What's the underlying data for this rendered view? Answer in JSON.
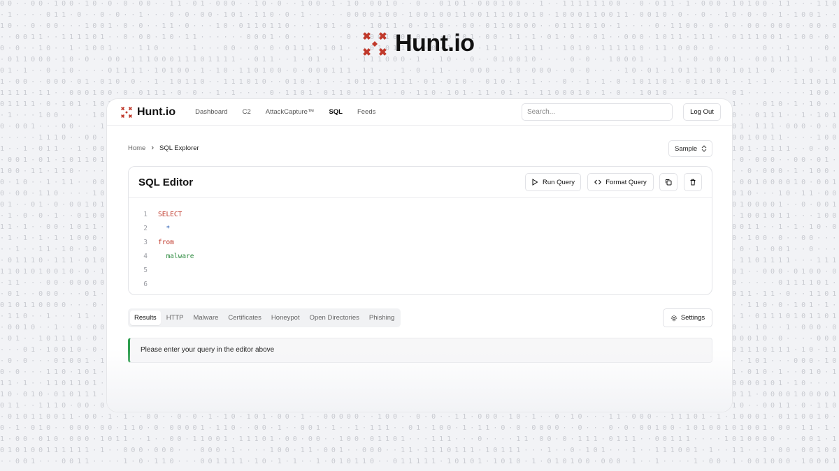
{
  "hero": {
    "brand": "Hunt.io"
  },
  "nav": {
    "brand": "Hunt.io",
    "links": [
      "Dashboard",
      "C2",
      "AttackCapture™",
      "SQL",
      "Feeds"
    ],
    "active": "SQL",
    "search_placeholder": "Search...",
    "logout_label": "Log Out"
  },
  "breadcrumb": {
    "home": "Home",
    "current": "SQL Explorer"
  },
  "sample_select": {
    "value": "Sample"
  },
  "editor": {
    "title": "SQL Editor",
    "run_label": "Run Query",
    "format_label": "Format Query",
    "lines": [
      {
        "n": "1",
        "text": "SELECT",
        "kind": "kw"
      },
      {
        "n": "2",
        "text": "  *",
        "kind": "op"
      },
      {
        "n": "3",
        "text": "from",
        "kind": "kw"
      },
      {
        "n": "4",
        "text": "  malware",
        "kind": "id"
      },
      {
        "n": "5",
        "text": "",
        "kind": "id"
      },
      {
        "n": "6",
        "text": "",
        "kind": "id"
      }
    ]
  },
  "tabs": [
    "Results",
    "HTTP",
    "Malware",
    "Certificates",
    "Honeypot",
    "Open Directories",
    "Phishing"
  ],
  "active_tab": "Results",
  "settings_label": "Settings",
  "message": "Please enter your query in the editor above",
  "colors": {
    "brand_red": "#c0392b",
    "success_green": "#2e9e4f"
  }
}
